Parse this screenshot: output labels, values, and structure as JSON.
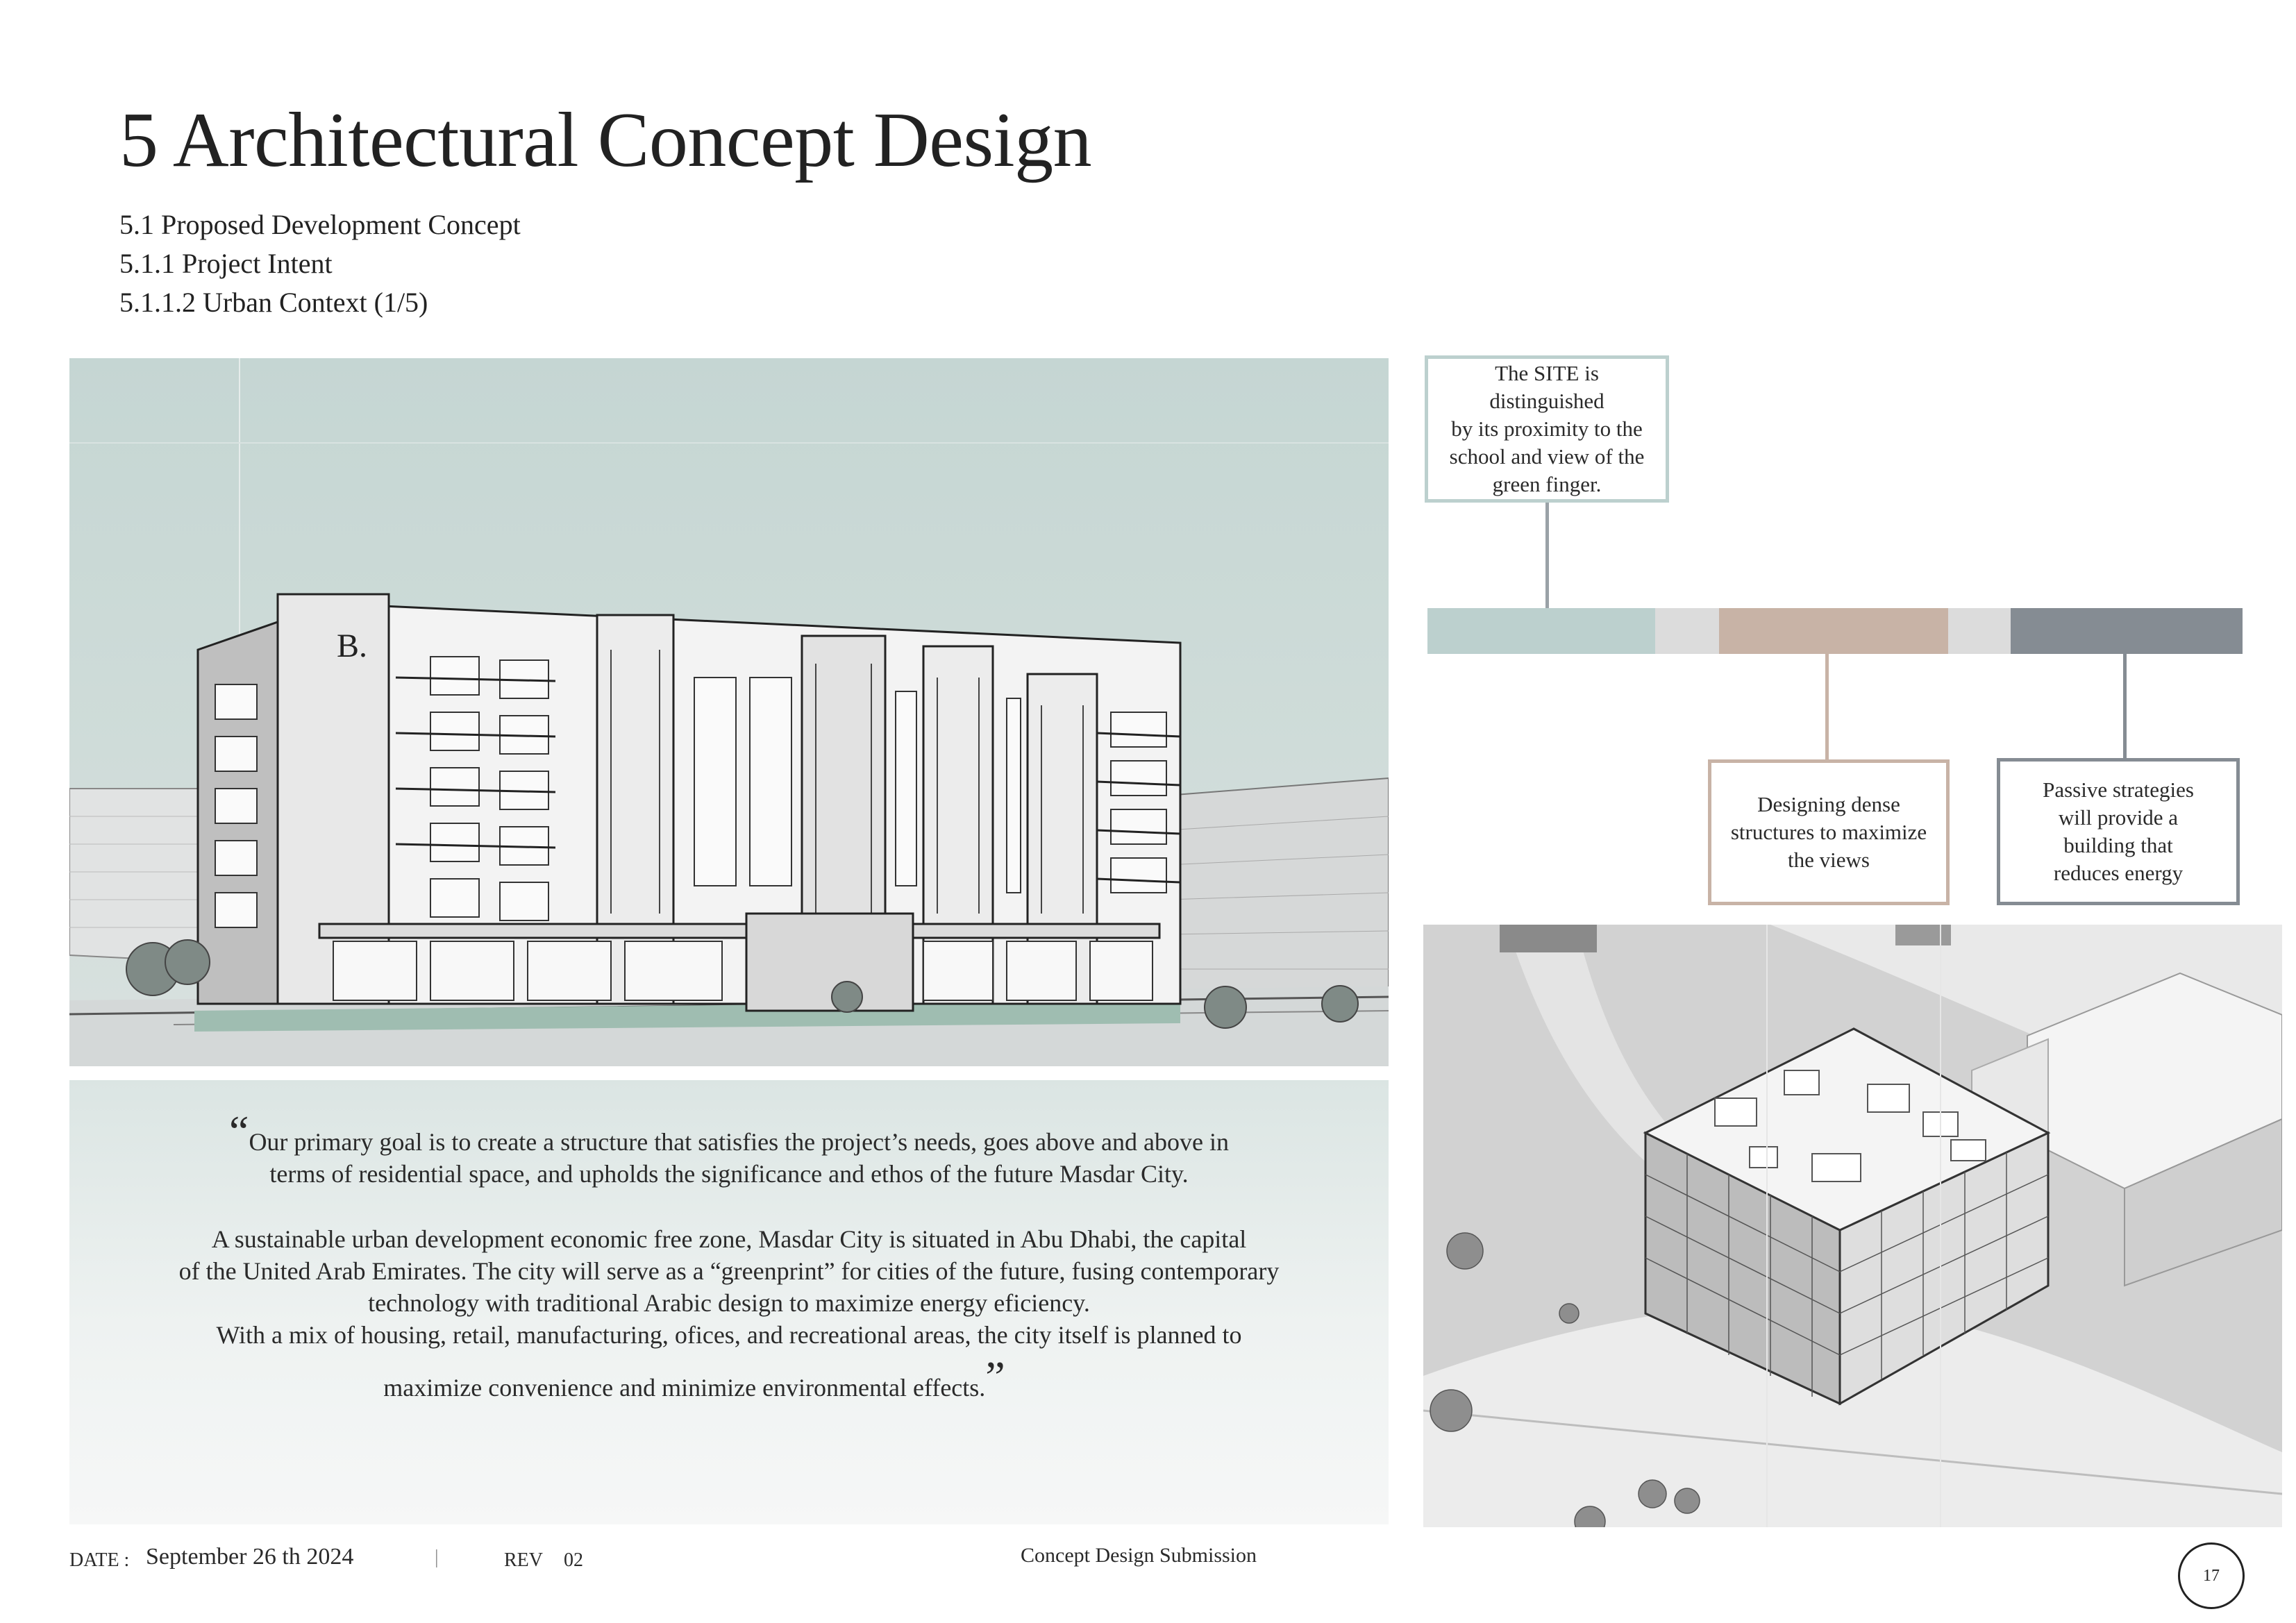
{
  "header": {
    "title": "5 Architectural Concept Design",
    "subtitles": [
      "5.1 Proposed Development Concept",
      "5.1.1 Project Intent",
      "5.1.1.2 Urban Context (1/5)"
    ]
  },
  "quote": {
    "open_mark": "“",
    "close_mark": "”",
    "lines": [
      "Our primary goal is to create a structure that satisfies the project’s needs, goes above and above in",
      "terms of residential space, and upholds the significance and ethos of the future Masdar City.",
      "A sustainable urban development economic free zone, Masdar City is situated in Abu Dhabi, the capital",
      "of the United Arab Emirates. The city will serve as a “greenprint” for cities of the future, fusing contemporary",
      "technology with traditional Arabic design to maximize energy eficiency.",
      "With a mix of housing, retail, manufacturing, ofices, and recreational areas, the city itself is planned to",
      "maximize convenience and minimize environmental effects."
    ]
  },
  "diagram": {
    "callouts": [
      {
        "lines": [
          "The SITE is distinguished",
          "by its proximity to the",
          "school and view of the",
          "green finger."
        ]
      },
      {
        "lines": [
          "Designing dense",
          "structures to maximize",
          "the views"
        ]
      },
      {
        "lines": [
          "Passive strategies",
          "will provide a",
          "building that",
          "reduces energy"
        ]
      }
    ],
    "colors": {
      "teal": "#bcd0ce",
      "light_gray": "#dcdcdc",
      "tan": "#c8b3a6",
      "slate": "#858c93"
    }
  },
  "building_logo": "B.",
  "footer": {
    "date_label": "DATE :",
    "date_value": "September 26 th 2024",
    "separator": "|",
    "rev_label": "REV",
    "rev_value": "02",
    "submission": "Concept Design Submission",
    "page_number": "17"
  }
}
